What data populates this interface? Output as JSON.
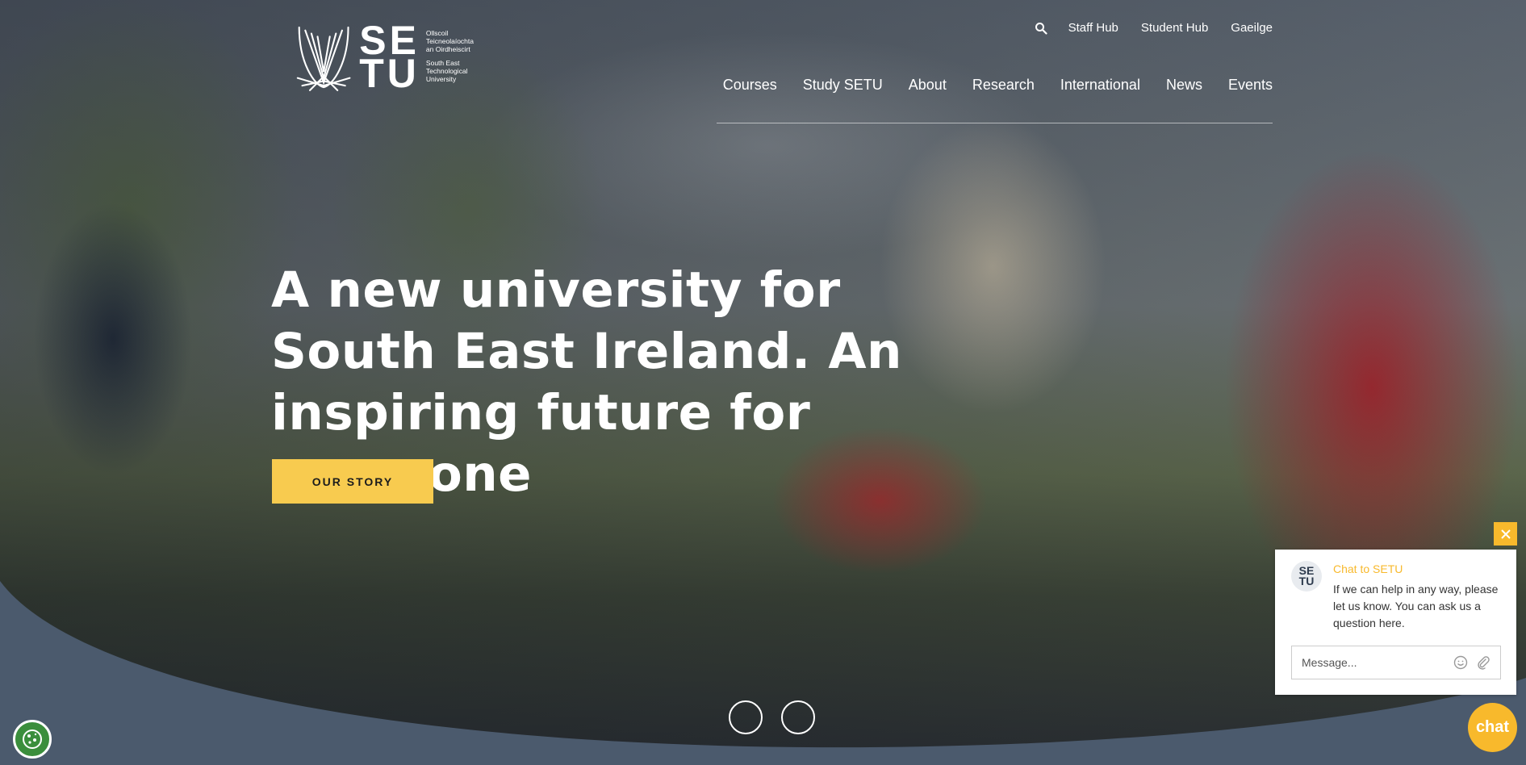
{
  "header": {
    "logo": {
      "letters": "SETU",
      "irish_lines": [
        "Ollscoil",
        "Teicneolaíochta",
        "an Oirdheiscirt"
      ],
      "english_lines": [
        "South East",
        "Technological",
        "University"
      ]
    },
    "utility_nav": {
      "search_icon": "search-icon",
      "items": [
        "Staff Hub",
        "Student Hub",
        "Gaeilge"
      ]
    },
    "main_nav": [
      "Courses",
      "Study SETU",
      "About",
      "Research",
      "International",
      "News",
      "Events"
    ]
  },
  "hero": {
    "headline": "A new university for South East Ireland. An inspiring future for everyone",
    "cta_label": "OUR STORY",
    "slides": 2
  },
  "cookie": {
    "icon": "cookie-icon"
  },
  "chat": {
    "avatar_lines": [
      "SE",
      "TU"
    ],
    "title": "Chat to SETU",
    "message": "If we can help in any way, please let us know. You can ask us a question here.",
    "input_placeholder": "Message...",
    "bubble_label": "chat",
    "close_icon": "close-icon"
  },
  "colors": {
    "accent": "#f8cb4f",
    "chat_accent": "#f8b92c",
    "curve": "#4b5a6d",
    "cookie": "#3b8e3c"
  }
}
